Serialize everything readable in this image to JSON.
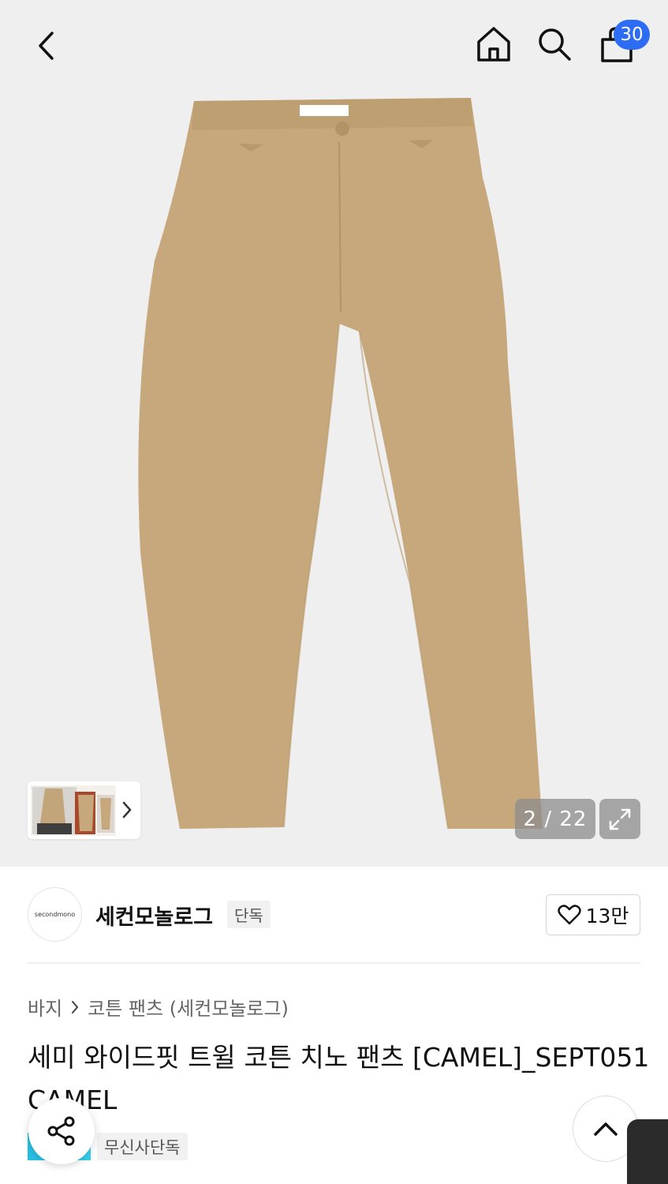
{
  "header": {
    "back_icon": "chevron-left-icon",
    "home_icon": "home-icon",
    "search_icon": "search-icon",
    "bag_icon": "shopping-bag-icon",
    "cart_count": "30"
  },
  "gallery": {
    "current": "2",
    "total": "22",
    "counter_text": "2 / 22",
    "expand_icon": "expand-icon",
    "thumb_chevron_icon": "chevron-right-icon",
    "product_color": "#c6a87c"
  },
  "brand": {
    "logo_text": "secondmono",
    "name": "세컨모놀로그",
    "tag": "단독",
    "likes": "13만",
    "heart_icon": "heart-icon"
  },
  "breadcrumb": {
    "category": "바지",
    "separator_icon": "chevron-right-icon",
    "subcategory": "코튼 팬츠 (세컨모놀로그)"
  },
  "product": {
    "title": "세미 와이드핏 트윌 코튼 치노 팬츠 [CAMEL]_SEPT051CAMEL",
    "badge": "무신사단독"
  },
  "fabs": {
    "share_icon": "share-icon",
    "scroll_top_icon": "chevron-up-icon"
  },
  "colors": {
    "accent": "#2d6cf5",
    "background_hero": "#efefef"
  }
}
